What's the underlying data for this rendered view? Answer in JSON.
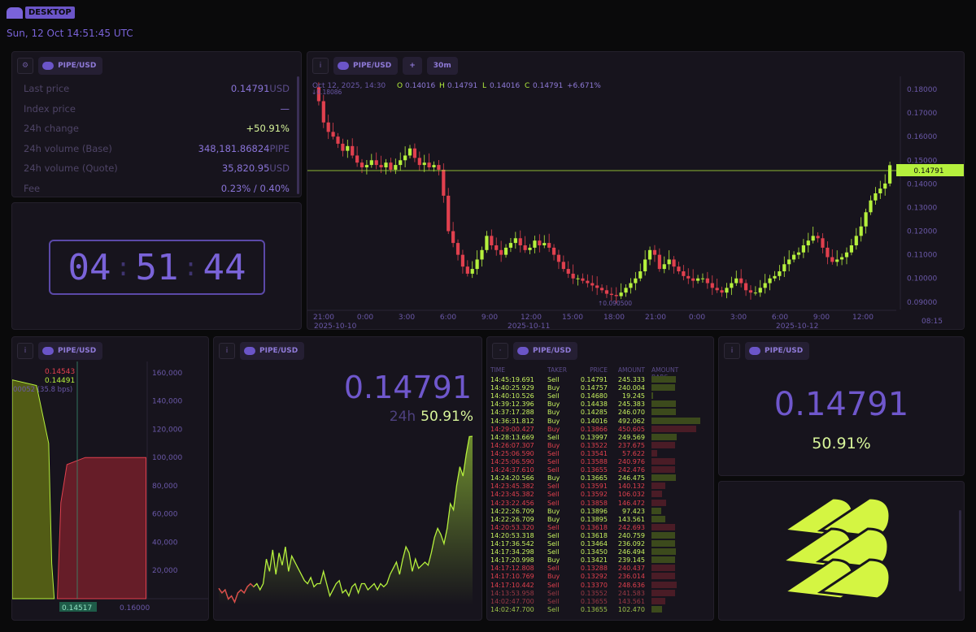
{
  "header": {
    "badge": "DESKTOP",
    "datetime": "Sun, 12 Oct 14:51:45 UTC"
  },
  "colors": {
    "accent": "#7c5cd6",
    "up": "#b5f03d",
    "down": "#e0404e",
    "bg": "#0a0a0b",
    "panel": "#17141d"
  },
  "ticker": {
    "pair": "PIPE/USD",
    "rows": [
      {
        "label": "Last price",
        "value": "0.14791",
        "unit": "USD"
      },
      {
        "label": "Index price",
        "value": "—",
        "unit": ""
      },
      {
        "label": "24h change",
        "value": "+50.91%",
        "unit": ""
      },
      {
        "label": "24h volume (Base)",
        "value": "348,181.86824",
        "unit": "PIPE"
      },
      {
        "label": "24h volume (Quote)",
        "value": "35,820.95",
        "unit": "USD"
      },
      {
        "label": "Fee",
        "value": "0.23% / 0.40%",
        "unit": ""
      }
    ]
  },
  "clock": {
    "h": "04",
    "m": "51",
    "s": "44"
  },
  "candles": {
    "pair": "PIPE/USD",
    "add": "+",
    "interval": "30m",
    "ohlc": {
      "date": "Oct 12, 2025, 14:30",
      "o_label": "O",
      "o": "0.14016",
      "h_label": "H",
      "h": "0.14791",
      "l_label": "L",
      "l": "0.14016",
      "c_label": "C",
      "c": "0.14791",
      "chg": "+6.671%"
    },
    "high_marker": "↓0.18086",
    "low_marker": "↑0.090500",
    "last_tag": "0.14791",
    "time_label": "08:15",
    "y_ticks": [
      "0.18000",
      "0.17000",
      "0.16000",
      "0.15000",
      "0.14000",
      "0.13000",
      "0.12000",
      "0.11000",
      "0.10000",
      "0.09000"
    ],
    "x_ticks": [
      "21:00",
      "0:00",
      "3:00",
      "6:00",
      "9:00",
      "12:00",
      "15:00",
      "18:00",
      "21:00",
      "0:00",
      "3:00",
      "6:00",
      "9:00",
      "12:00"
    ],
    "x_dates": [
      "2025-10-10",
      "2025-10-11",
      "2025-10-12"
    ]
  },
  "chart_data": [
    {
      "type": "line",
      "title": "PIPE/USD 30m",
      "ylim": [
        0.0865,
        0.1855
      ],
      "y_ticks": [
        0.18,
        0.17,
        0.16,
        0.15,
        0.14,
        0.13,
        0.12,
        0.11,
        0.1,
        0.09
      ],
      "series": [
        {
          "name": "PIPE/USD",
          "values": [
            0.18086,
            0.175,
            0.166,
            0.162,
            0.16,
            0.157,
            0.154,
            0.156,
            0.152,
            0.149,
            0.147,
            0.148,
            0.15,
            0.148,
            0.147,
            0.149,
            0.146,
            0.148,
            0.15,
            0.152,
            0.155,
            0.151,
            0.148,
            0.149,
            0.147,
            0.148,
            0.146,
            0.135,
            0.12,
            0.115,
            0.11,
            0.105,
            0.102,
            0.104,
            0.108,
            0.112,
            0.118,
            0.114,
            0.112,
            0.11,
            0.113,
            0.115,
            0.117,
            0.114,
            0.112,
            0.113,
            0.116,
            0.114,
            0.115,
            0.113,
            0.11,
            0.107,
            0.104,
            0.102,
            0.1,
            0.1,
            0.099,
            0.098,
            0.097,
            0.096,
            0.095,
            0.0935,
            0.093,
            0.0925,
            0.094,
            0.096,
            0.098,
            0.1,
            0.103,
            0.108,
            0.112,
            0.11,
            0.104,
            0.106,
            0.108,
            0.105,
            0.103,
            0.101,
            0.1,
            0.099,
            0.1,
            0.1,
            0.098,
            0.096,
            0.095,
            0.094,
            0.096,
            0.098,
            0.1,
            0.098,
            0.095,
            0.094,
            0.094,
            0.096,
            0.098,
            0.1,
            0.101,
            0.103,
            0.106,
            0.108,
            0.11,
            0.111,
            0.114,
            0.116,
            0.118,
            0.117,
            0.113,
            0.109,
            0.107,
            0.108,
            0.109,
            0.111,
            0.114,
            0.118,
            0.122,
            0.128,
            0.133,
            0.136,
            0.138,
            0.14016,
            0.14791
          ]
        }
      ]
    },
    {
      "type": "area",
      "title": "Depth",
      "x_ticks": [
        0.14517,
        0.16
      ],
      "y_ticks": [
        160000,
        140000,
        120000,
        100000,
        80000,
        60000,
        40000,
        20000
      ],
      "ylim": [
        0,
        168000
      ],
      "series": [
        {
          "name": "bids",
          "values": [
            [
              0.138,
              155000
            ],
            [
              0.142,
              151000
            ],
            [
              0.144,
              110000
            ],
            [
              0.1445,
              25000
            ],
            [
              0.14491,
              0
            ]
          ]
        },
        {
          "name": "asks",
          "values": [
            [
              0.14543,
              0
            ],
            [
              0.146,
              68000
            ],
            [
              0.147,
              95000
            ],
            [
              0.15,
              100000
            ],
            [
              0.16,
              100000
            ]
          ]
        }
      ]
    },
    {
      "type": "line",
      "title": "PIPE/USD 24h",
      "series": [
        {
          "name": "PIPE/USD",
          "values": [
            0.0985,
            0.097,
            0.098,
            0.095,
            0.096,
            0.094,
            0.097,
            0.098,
            0.097,
            0.099,
            0.1,
            0.099,
            0.1,
            0.098,
            0.1,
            0.108,
            0.104,
            0.111,
            0.103,
            0.11,
            0.106,
            0.112,
            0.104,
            0.109,
            0.107,
            0.105,
            0.103,
            0.101,
            0.1,
            0.102,
            0.099,
            0.1,
            0.1,
            0.104,
            0.1,
            0.096,
            0.098,
            0.1,
            0.101,
            0.097,
            0.098,
            0.096,
            0.099,
            0.1,
            0.097,
            0.1,
            0.1,
            0.098,
            0.099,
            0.1,
            0.098,
            0.1,
            0.099,
            0.1,
            0.103,
            0.105,
            0.107,
            0.103,
            0.108,
            0.112,
            0.11,
            0.104,
            0.108,
            0.105,
            0.106,
            0.107,
            0.106,
            0.11,
            0.115,
            0.118,
            0.116,
            0.113,
            0.118,
            0.126,
            0.124,
            0.132,
            0.138,
            0.135,
            0.142,
            0.1478,
            0.14791
          ]
        }
      ]
    }
  ],
  "depth": {
    "pair": "PIPE/USD",
    "ask_price": "0.14543",
    "bid_price": "0.14491",
    "spread": "00052 (35.8 bps)",
    "mid_tag": "0.14517",
    "x_right": "0.16000",
    "y_ticks": [
      "160,000",
      "140,000",
      "120,000",
      "100,000",
      "80,000",
      "60,000",
      "40,000",
      "20,000"
    ]
  },
  "spark": {
    "pair": "PIPE/USD",
    "price": "0.14791",
    "change_label": "24h",
    "change": "50.91%"
  },
  "trades": {
    "pair": "PIPE/USD",
    "headers": [
      "TIME",
      "TAKER",
      "PRICE",
      "AMOUNT",
      "AMOUNT BARS"
    ],
    "rows": [
      [
        "14:45:19.691",
        "Sell",
        "0.14791",
        "245.333",
        "up",
        0.5
      ],
      [
        "14:40:25.929",
        "Buy",
        "0.14757",
        "240.004",
        "up",
        0.49
      ],
      [
        "14:40:10.526",
        "Sell",
        "0.14680",
        "19.245",
        "up",
        0.04
      ],
      [
        "14:39:12.396",
        "Buy",
        "0.14438",
        "245.383",
        "up",
        0.5
      ],
      [
        "14:37:17.288",
        "Buy",
        "0.14285",
        "246.070",
        "up",
        0.5
      ],
      [
        "14:36:31.812",
        "Buy",
        "0.14016",
        "492.062",
        "up",
        1.0
      ],
      [
        "14:29:00.427",
        "Buy",
        "0.13866",
        "450.605",
        "down",
        0.92
      ],
      [
        "14:28:13.669",
        "Sell",
        "0.13997",
        "249.569",
        "up",
        0.51
      ],
      [
        "14:26:07.307",
        "Buy",
        "0.13522",
        "237.675",
        "down",
        0.48
      ],
      [
        "14:25:06.590",
        "Sell",
        "0.13541",
        "57.622",
        "down",
        0.12
      ],
      [
        "14:25:06.590",
        "Sell",
        "0.13588",
        "240.976",
        "down",
        0.49
      ],
      [
        "14:24:37.610",
        "Sell",
        "0.13655",
        "242.476",
        "down",
        0.49
      ],
      [
        "14:24:20.566",
        "Buy",
        "0.13665",
        "246.475",
        "up",
        0.5
      ],
      [
        "14:23:45.382",
        "Sell",
        "0.13591",
        "140.132",
        "down",
        0.28
      ],
      [
        "14:23:45.382",
        "Sell",
        "0.13592",
        "106.032",
        "down",
        0.22
      ],
      [
        "14:23:22.456",
        "Sell",
        "0.13858",
        "146.472",
        "down",
        0.3
      ],
      [
        "14:22:26.709",
        "Buy",
        "0.13896",
        "97.423",
        "up",
        0.2
      ],
      [
        "14:22:26.709",
        "Buy",
        "0.13895",
        "143.561",
        "up",
        0.29
      ],
      [
        "14:20:53.320",
        "Sell",
        "0.13618",
        "242.693",
        "down",
        0.49
      ],
      [
        "14:20:53.318",
        "Sell",
        "0.13618",
        "240.759",
        "up",
        0.49
      ],
      [
        "14:17:36.542",
        "Sell",
        "0.13464",
        "236.092",
        "up",
        0.48
      ],
      [
        "14:17:34.298",
        "Sell",
        "0.13450",
        "246.494",
        "up",
        0.5
      ],
      [
        "14:17:20.998",
        "Buy",
        "0.13421",
        "239.145",
        "up",
        0.49
      ],
      [
        "14:17:12.808",
        "Sell",
        "0.13288",
        "240.437",
        "down",
        0.49
      ],
      [
        "14:17:10.769",
        "Buy",
        "0.13292",
        "236.014",
        "down",
        0.48
      ],
      [
        "14:17:10.442",
        "Sell",
        "0.13370",
        "248.636",
        "down",
        0.51
      ],
      [
        "14:13:53.958",
        "Sell",
        "0.13552",
        "241.583",
        "down",
        0.49
      ],
      [
        "14:02:47.700",
        "Sell",
        "0.13655",
        "143.561",
        "down",
        0.29
      ],
      [
        "14:02:47.700",
        "Sell",
        "0.13655",
        "102.470",
        "up",
        0.21
      ]
    ]
  },
  "big": {
    "pair": "PIPE/USD",
    "price": "0.14791",
    "change": "50.91%"
  }
}
